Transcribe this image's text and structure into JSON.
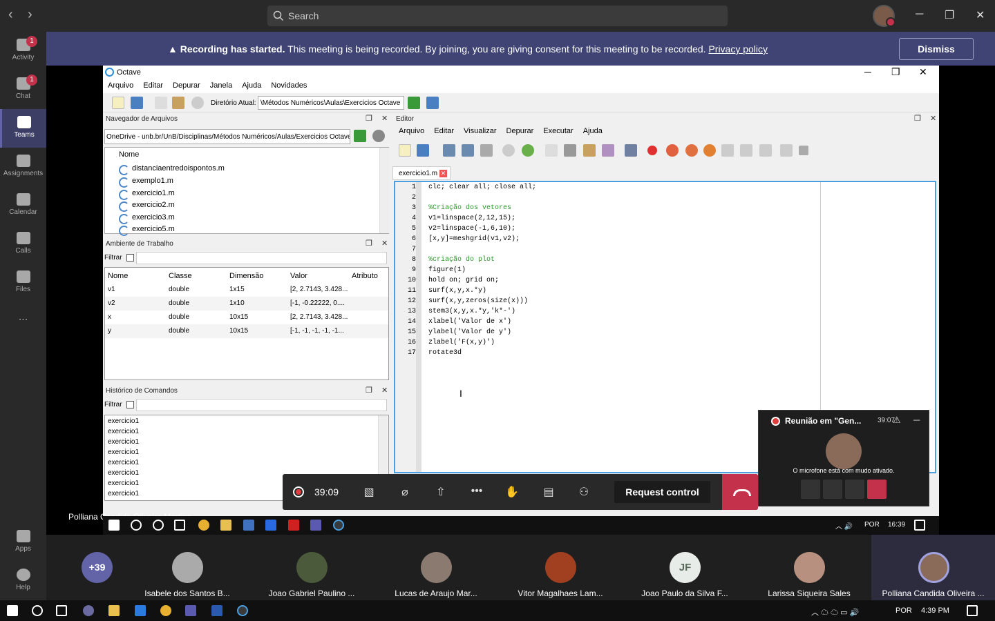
{
  "teams": {
    "search_placeholder": "Search",
    "rail": [
      {
        "label": "Activity",
        "badge": "1"
      },
      {
        "label": "Chat",
        "badge": "1"
      },
      {
        "label": "Teams"
      },
      {
        "label": "Assignments"
      },
      {
        "label": "Calendar"
      },
      {
        "label": "Calls"
      },
      {
        "label": "Files"
      },
      {
        "label": "..."
      },
      {
        "label": "Apps"
      },
      {
        "label": "Help"
      }
    ],
    "banner": {
      "bold": "Recording has started.",
      "text": " This meeting is being recorded. By joining, you are giving consent for this meeting to be recorded. ",
      "link": "Privacy policy",
      "dismiss": "Dismiss"
    }
  },
  "octave": {
    "title": "Octave",
    "menu": [
      "Arquivo",
      "Editar",
      "Depurar",
      "Janela",
      "Ajuda",
      "Novidades"
    ],
    "dir_label": "Diretório Atual:",
    "dir_value": "\\Métodos Numéricos\\Aulas\\Exercicios Octave",
    "file_browser": {
      "title": "Navegador de Arquivos",
      "path": "OneDrive - unb.br/UnB/Disciplinas/Métodos Numéricos/Aulas/Exercicios Octave",
      "header": "Nome",
      "files": [
        "distanciaentredoispontos.m",
        "exemplo1.m",
        "exercicio1.m",
        "exercicio2.m",
        "exercicio3.m",
        "exercicio5.m"
      ]
    },
    "workspace": {
      "title": "Ambiente de Trabalho",
      "filter": "Filtrar",
      "headers": [
        "Nome",
        "Classe",
        "Dimensão",
        "Valor",
        "Atributo"
      ],
      "rows": [
        [
          "v1",
          "double",
          "1x15",
          "[2, 2.7143, 3.428..."
        ],
        [
          "v2",
          "double",
          "1x10",
          "[-1, -0.22222, 0...."
        ],
        [
          "x",
          "double",
          "10x15",
          "[2, 2.7143, 3.428..."
        ],
        [
          "y",
          "double",
          "10x15",
          "[-1, -1, -1, -1, -1..."
        ]
      ]
    },
    "history": {
      "title": "Histórico de Comandos",
      "filter": "Filtrar",
      "items": [
        "exercicio1",
        "exercicio1",
        "exercicio1",
        "exercicio1",
        "exercicio1",
        "exercicio1",
        "exercicio1",
        "exercicio1"
      ]
    },
    "editor": {
      "title": "Editor",
      "menu": [
        "Arquivo",
        "Editar",
        "Visualizar",
        "Depurar",
        "Executar",
        "Ajuda"
      ],
      "tab": "exercicio1.m",
      "lines": [
        "clc; clear all; close all;",
        "",
        "%Criação dos vetores",
        "v1=linspace(2,12,15);",
        "v2=linspace(-1,6,10);",
        "[x,y]=meshgrid(v1,v2);",
        "",
        "%criação do plot",
        "figure(1)",
        "hold on; grid on;",
        "surf(x,y,x.*y)",
        "surf(x,y,zeros(size(x)))",
        "stem3(x,y,x.*y,'k*-')",
        "xlabel('Valor de x')",
        "ylabel('Valor de y')",
        "zlabel('F(x,y)')",
        "rotate3d"
      ]
    }
  },
  "presenter_name": "Polliana Candida Oliveira Martins",
  "inner_taskbar": {
    "lang": "POR",
    "time": "16:39"
  },
  "call": {
    "timer": "39:09",
    "request_control": "Request control"
  },
  "mini_window": {
    "title": "Reunião em \"Gen...",
    "time": "39:07",
    "message": "O microfone está com mudo ativado."
  },
  "participants": {
    "more": "+39",
    "list": [
      "Isabele dos Santos B...",
      "Joao Gabriel Paulino ...",
      "Lucas de Araujo Mar...",
      "Vitor Magalhaes Lam...",
      "Joao Paulo da Silva F...",
      "Larissa Siqueira Sales",
      "Polliana Candida Oliveira ..."
    ],
    "initials": "JF"
  },
  "windows_taskbar": {
    "lang": "POR",
    "time": "4:39 PM"
  }
}
